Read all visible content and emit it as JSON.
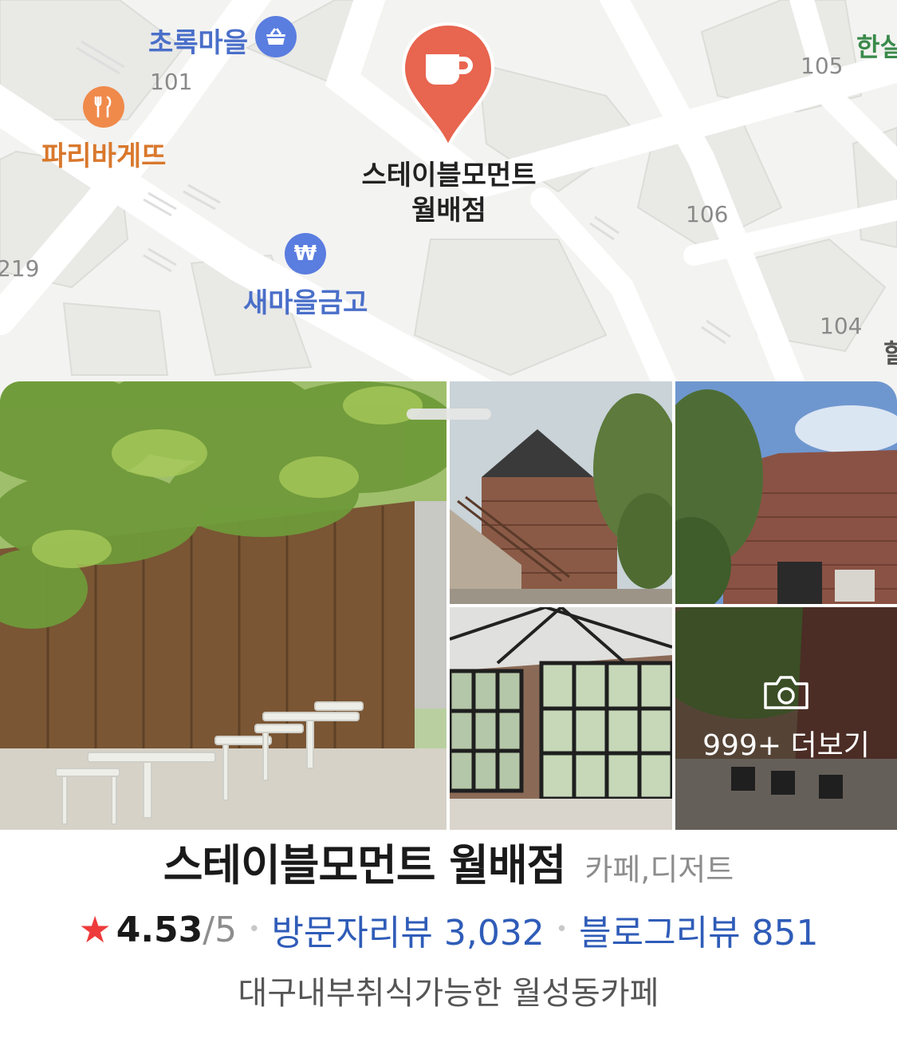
{
  "map": {
    "selected_place_label_line1": "스테이블모먼트",
    "selected_place_label_line2": "월배점",
    "selected_pin_icon": "coffee-cup-icon",
    "pin_color": "#e8654f",
    "pois": [
      {
        "label": "초록마을",
        "icon": "shopping-basket-icon",
        "color": "#4a6fc9"
      },
      {
        "label": "파리바게뜨",
        "icon": "fork-knife-icon",
        "color": "#d9782d"
      },
      {
        "label": "새마을금고",
        "icon": "won-currency-icon",
        "color": "#4a6fc9"
      }
    ],
    "numbers": [
      "101",
      "105",
      "106",
      "104",
      "219"
    ],
    "edge_labels": [
      "한실",
      "할"
    ]
  },
  "gallery": {
    "more_label": "999+ 더보기",
    "more_icon": "camera-icon"
  },
  "place": {
    "name": "스테이블모먼트 월배점",
    "category": "카페,디저트",
    "rating": "4.53",
    "rating_max": "/5",
    "visitor_reviews": "방문자리뷰 3,032",
    "blog_reviews": "블로그리뷰 851",
    "description": "대구내부취식가능한 월성동카페"
  },
  "colors": {
    "link": "#2f5cb8",
    "star": "#ee3b3b"
  }
}
